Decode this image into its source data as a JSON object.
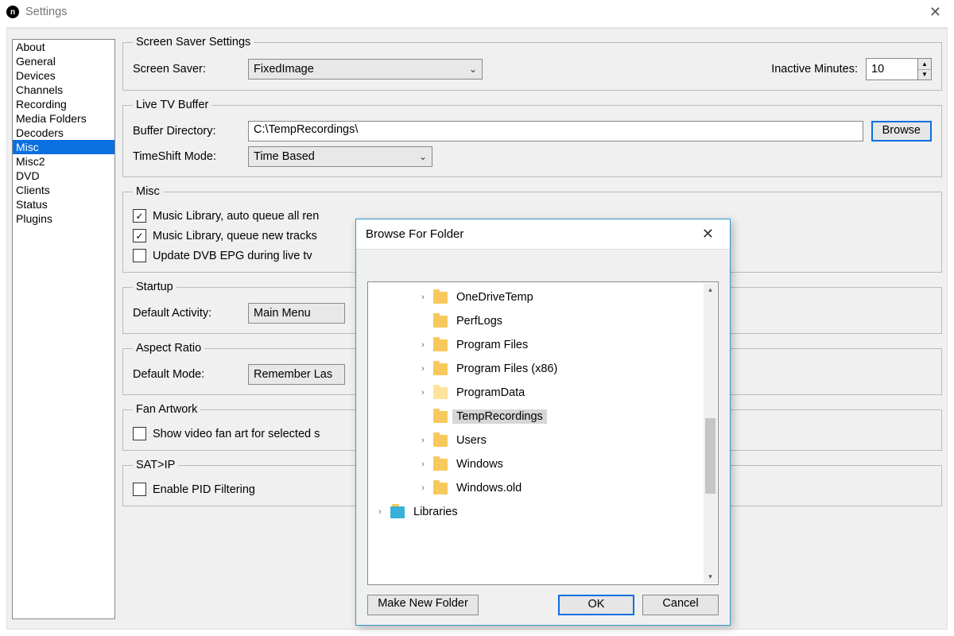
{
  "window": {
    "title": "Settings"
  },
  "sidebar": {
    "items": [
      "About",
      "General",
      "Devices",
      "Channels",
      "Recording",
      "Media Folders",
      "Decoders",
      "Misc",
      "Misc2",
      "DVD",
      "Clients",
      "Status",
      "Plugins"
    ],
    "selected_index": 7
  },
  "screensaver": {
    "legend": "Screen Saver Settings",
    "label": "Screen Saver:",
    "value": "FixedImage",
    "inactive_label": "Inactive Minutes:",
    "inactive_value": "10"
  },
  "buffer": {
    "legend": "Live TV Buffer",
    "dir_label": "Buffer Directory:",
    "dir_value": "C:\\TempRecordings\\",
    "browse": "Browse",
    "mode_label": "TimeShift Mode:",
    "mode_value": "Time Based"
  },
  "misc": {
    "legend": "Misc",
    "chk1": "Music Library, auto queue all ren",
    "chk2": "Music Library, queue new tracks",
    "chk3": "Update DVB EPG during live tv",
    "chk1_checked": true,
    "chk2_checked": true,
    "chk3_checked": false
  },
  "startup": {
    "legend": "Startup",
    "label": "Default Activity:",
    "value": "Main Menu"
  },
  "aspect": {
    "legend": "Aspect Ratio",
    "label": "Default Mode:",
    "value": "Remember Las"
  },
  "fanart": {
    "legend": "Fan Artwork",
    "chk": "Show video fan art for selected s",
    "checked": false
  },
  "satip": {
    "legend": "SAT>IP",
    "chk": "Enable PID Filtering",
    "checked": false
  },
  "dialog": {
    "title": "Browse For Folder",
    "make": "Make New Folder",
    "ok": "OK",
    "cancel": "Cancel",
    "tree": [
      {
        "label": "OneDriveTemp",
        "expander": true,
        "indent": 1,
        "icon": "folder",
        "selected": false
      },
      {
        "label": "PerfLogs",
        "expander": false,
        "indent": 1,
        "icon": "folder",
        "selected": false
      },
      {
        "label": "Program Files",
        "expander": true,
        "indent": 1,
        "icon": "folder",
        "selected": false
      },
      {
        "label": "Program Files (x86)",
        "expander": true,
        "indent": 1,
        "icon": "folder",
        "selected": false
      },
      {
        "label": "ProgramData",
        "expander": true,
        "indent": 1,
        "icon": "folder-light",
        "selected": false
      },
      {
        "label": "TempRecordings",
        "expander": false,
        "indent": 1,
        "icon": "folder",
        "selected": true
      },
      {
        "label": "Users",
        "expander": true,
        "indent": 1,
        "icon": "folder",
        "selected": false
      },
      {
        "label": "Windows",
        "expander": true,
        "indent": 1,
        "icon": "folder",
        "selected": false
      },
      {
        "label": "Windows.old",
        "expander": true,
        "indent": 1,
        "icon": "folder",
        "selected": false
      },
      {
        "label": "Libraries",
        "expander": true,
        "indent": 0,
        "icon": "lib",
        "selected": false
      }
    ]
  }
}
